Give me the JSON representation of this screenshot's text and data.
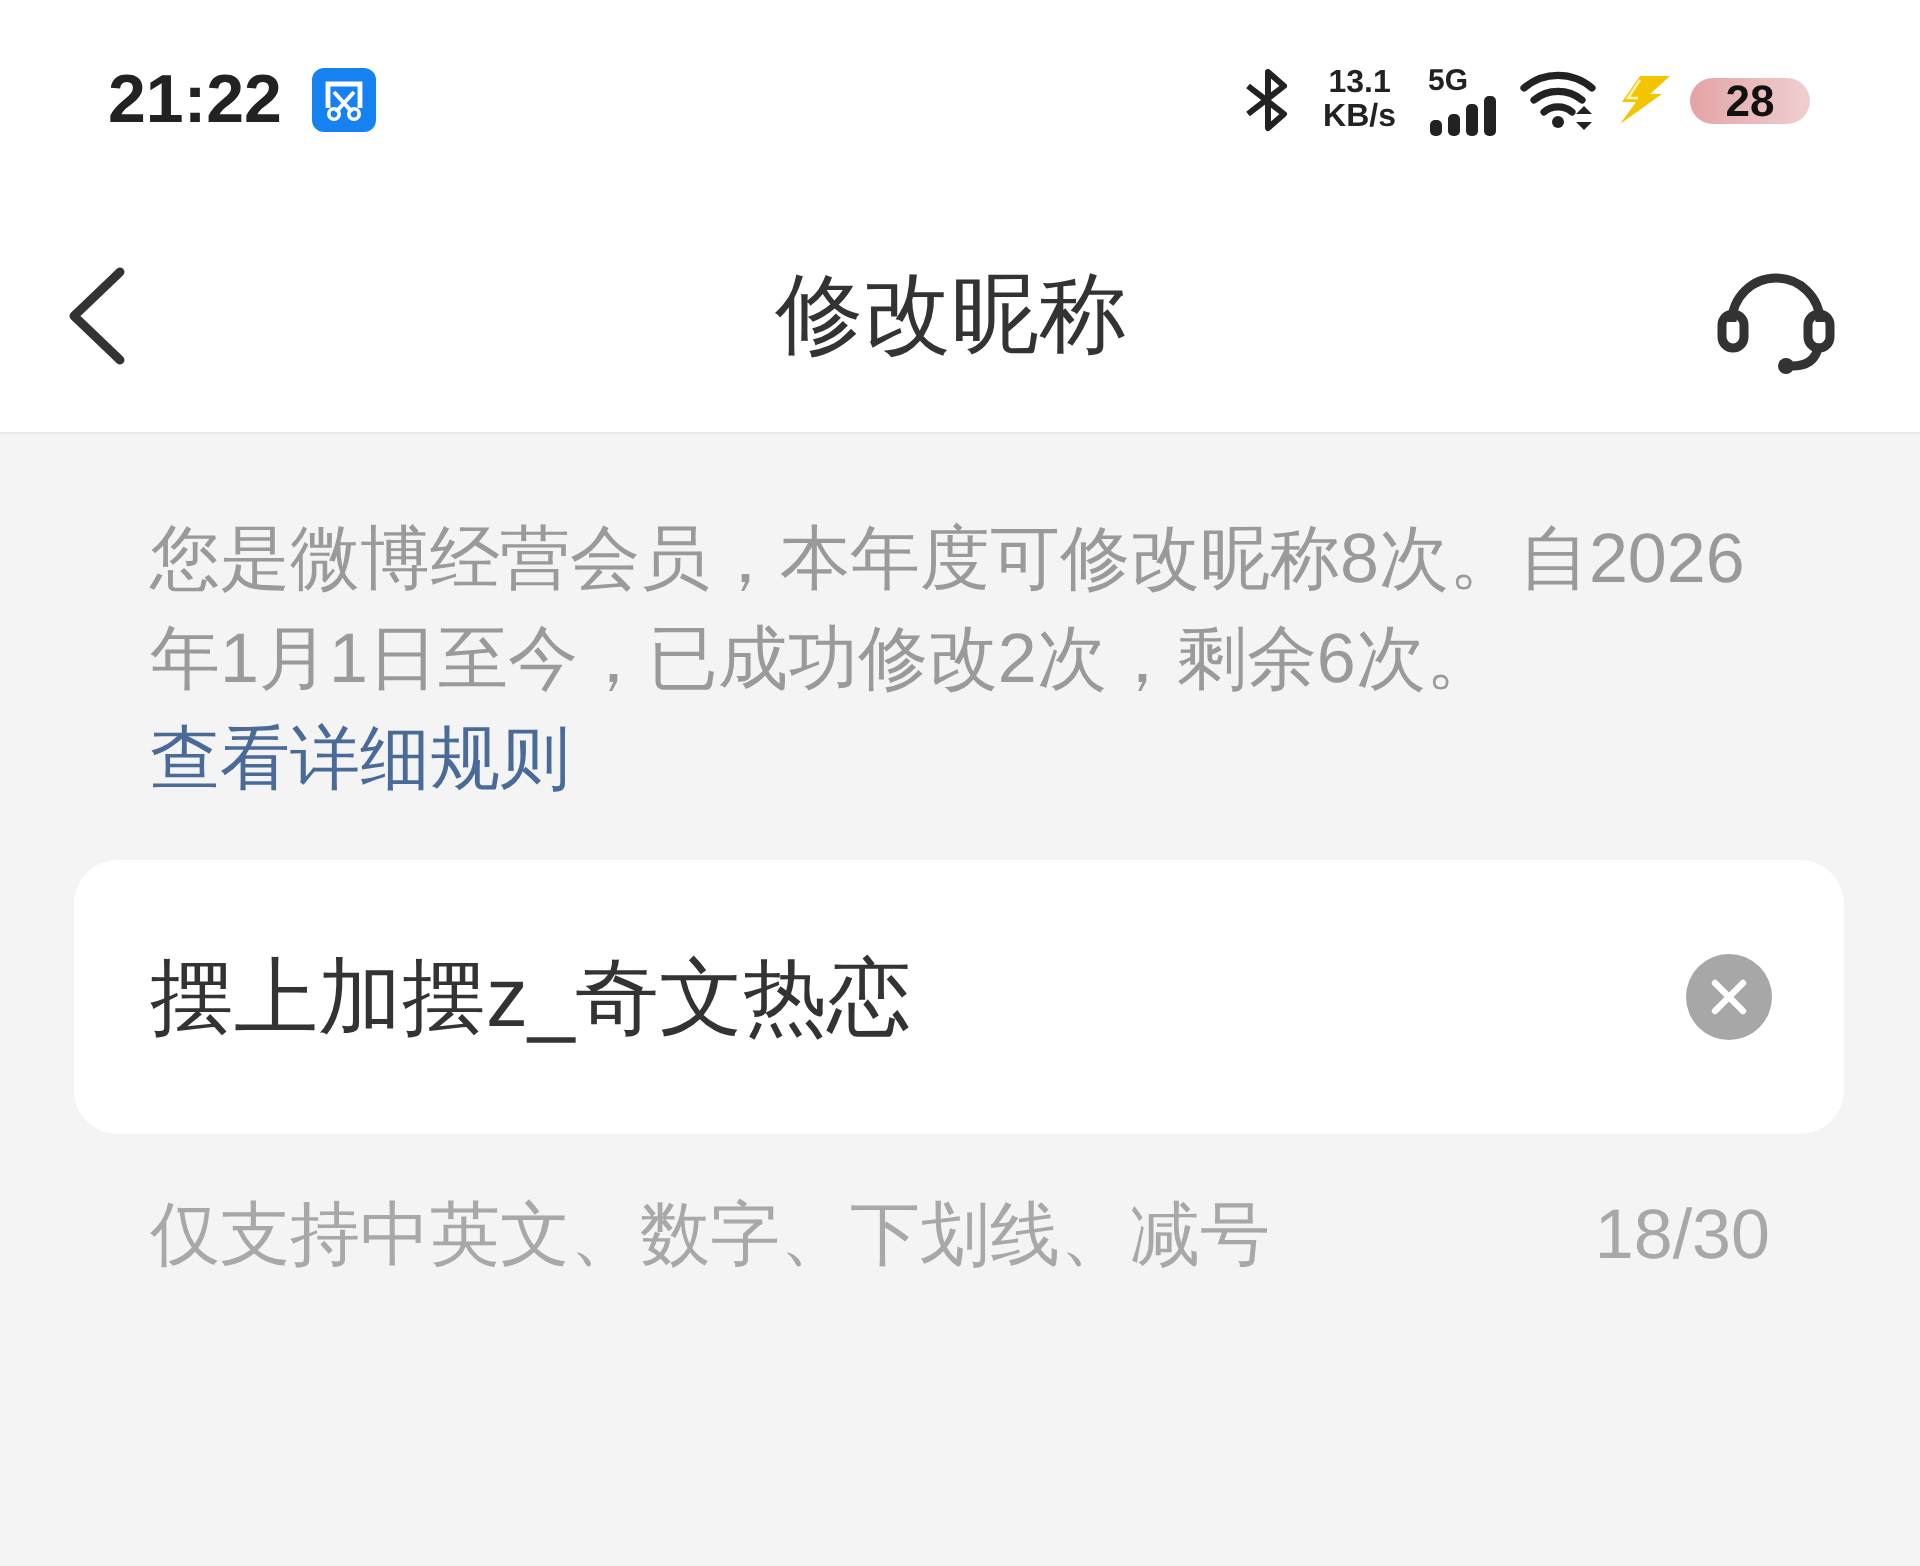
{
  "status_bar": {
    "time": "21:22",
    "network_speed": "13.1",
    "network_speed_unit": "KB/s",
    "network_type": "5G",
    "battery": "28",
    "charging": true
  },
  "header": {
    "title": "修改昵称"
  },
  "notice": {
    "text": "您是微博经营会员，本年度可修改昵称8次。自2026年1月1日至今，已成功修改2次，剩余6次。",
    "link": "查看详细规则"
  },
  "nickname_field": {
    "value": "摆上加摆z_奇文热恋",
    "hint": "仅支持中英文、数字、下划线、减号",
    "counter": "18/30"
  }
}
